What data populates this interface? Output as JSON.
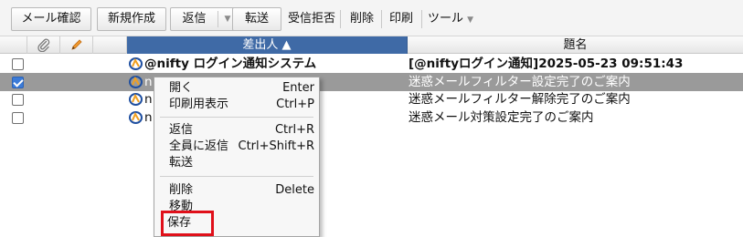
{
  "toolbar": {
    "mail_check": "メール確認",
    "new_create": "新規作成",
    "reply": "返信",
    "forward": "転送",
    "block": "受信拒否",
    "delete": "削除",
    "print": "印刷",
    "tools": "ツール",
    "caret": "▼"
  },
  "grid": {
    "headers": {
      "sender": "差出人 ▲",
      "subject": "題名"
    },
    "rows": [
      {
        "checked": false,
        "selected": false,
        "bold": true,
        "sender": "@nifty ログイン通知システム",
        "subject": "[@niftyログイン通知]2025-05-23 09:51:43"
      },
      {
        "checked": true,
        "selected": true,
        "bold": false,
        "sender": "n",
        "subject": "迷惑メールフィルター設定完了のご案内"
      },
      {
        "checked": false,
        "selected": false,
        "bold": false,
        "sender": "n",
        "subject": "迷惑メールフィルター解除完了のご案内"
      },
      {
        "checked": false,
        "selected": false,
        "bold": false,
        "sender": "n",
        "subject": "迷惑メール対策設定完了のご案内"
      }
    ]
  },
  "context_menu": {
    "items": [
      {
        "label": "開く",
        "shortcut": "Enter"
      },
      {
        "label": "印刷用表示",
        "shortcut": "Ctrl+P"
      },
      {
        "label": "返信",
        "shortcut": "Ctrl+R"
      },
      {
        "label": "全員に返信",
        "shortcut": "Ctrl+Shift+R"
      },
      {
        "label": "転送",
        "shortcut": ""
      },
      {
        "label": "削除",
        "shortcut": "Delete"
      },
      {
        "label": "移動",
        "shortcut": ""
      },
      {
        "label": "保存",
        "shortcut": ""
      }
    ]
  },
  "colors": {
    "sorted_header": "#3f6aa6",
    "selected_row": "#9a9a9a",
    "highlight_box": "#e0101a",
    "check_blue": "#3b7bd8"
  }
}
